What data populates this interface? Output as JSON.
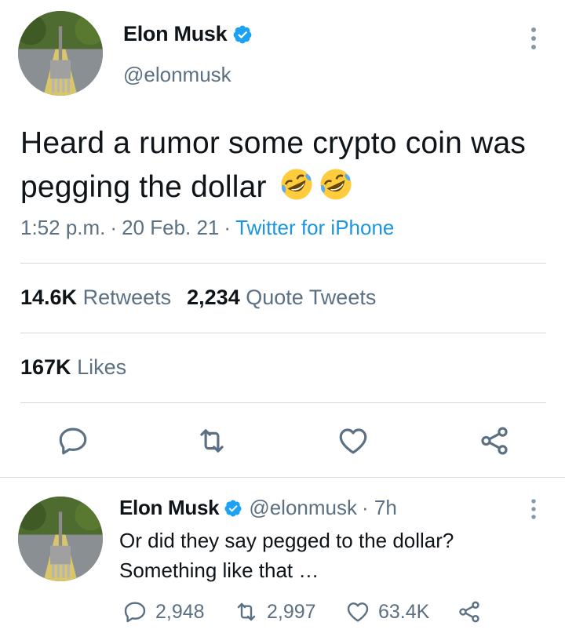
{
  "tweet": {
    "author": {
      "name": "Elon Musk",
      "handle": "@elonmusk",
      "verified": true
    },
    "text": "Heard a rumor some crypto coin was pegging the dollar",
    "emojis": [
      "rolling-on-floor-laughing",
      "rolling-on-floor-laughing"
    ],
    "time": "1:52 p.m.",
    "separator": "·",
    "date": "20 Feb. 21",
    "source": "Twitter for iPhone",
    "stats": {
      "retweets_count": "14.6K",
      "retweets_label": "Retweets",
      "quotes_count": "2,234",
      "quotes_label": "Quote Tweets",
      "likes_count": "167K",
      "likes_label": "Likes"
    }
  },
  "reply": {
    "author": {
      "name": "Elon Musk",
      "handle": "@elonmusk",
      "verified": true
    },
    "age": "· 7h",
    "text_line1": "Or did they say pegged to the dollar?",
    "text_line2": "Something like that …",
    "counts": {
      "replies": "2,948",
      "retweets": "2,997",
      "likes": "63.4K"
    }
  },
  "colors": {
    "accent": "#1da1f2",
    "link": "#1b95e0",
    "secondary_text": "#5b7083",
    "divider": "#cfd9de"
  },
  "icons": [
    "verified-badge-icon",
    "more-icon",
    "reply-icon",
    "retweet-icon",
    "like-icon",
    "share-icon"
  ]
}
